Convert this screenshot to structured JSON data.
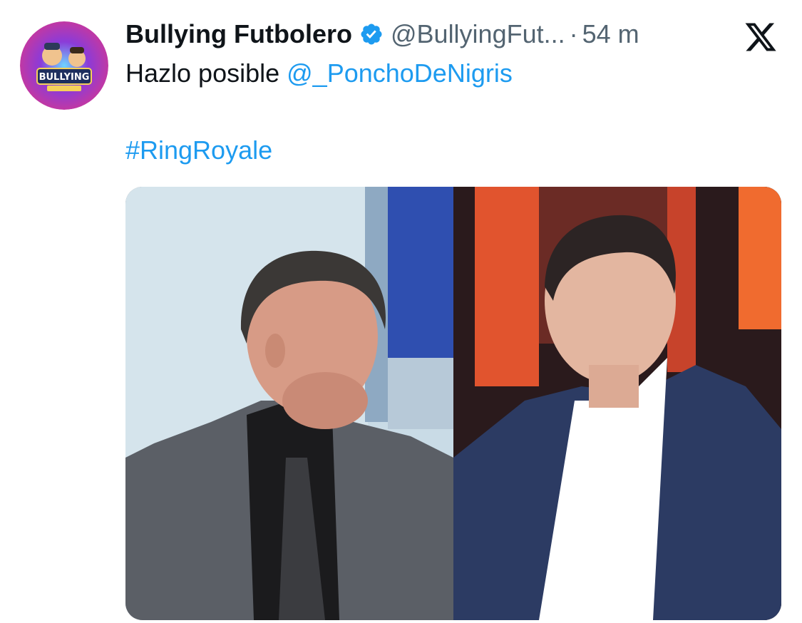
{
  "tweet": {
    "author_name": "Bullying Futbolero",
    "handle": "@BullyingFut...",
    "separator": "·",
    "time": "54 m",
    "text_prefix": "Hazlo posible",
    "mention": "@_PonchoDeNigris",
    "hashtag": "#RingRoyale",
    "avatar_text": "BULLYING"
  },
  "icons": {
    "verified": "verified-badge-icon",
    "platform": "x-logo-icon"
  },
  "colors": {
    "link": "#1d9bf0",
    "muted": "#536471",
    "verified": "#1d9bf0"
  }
}
